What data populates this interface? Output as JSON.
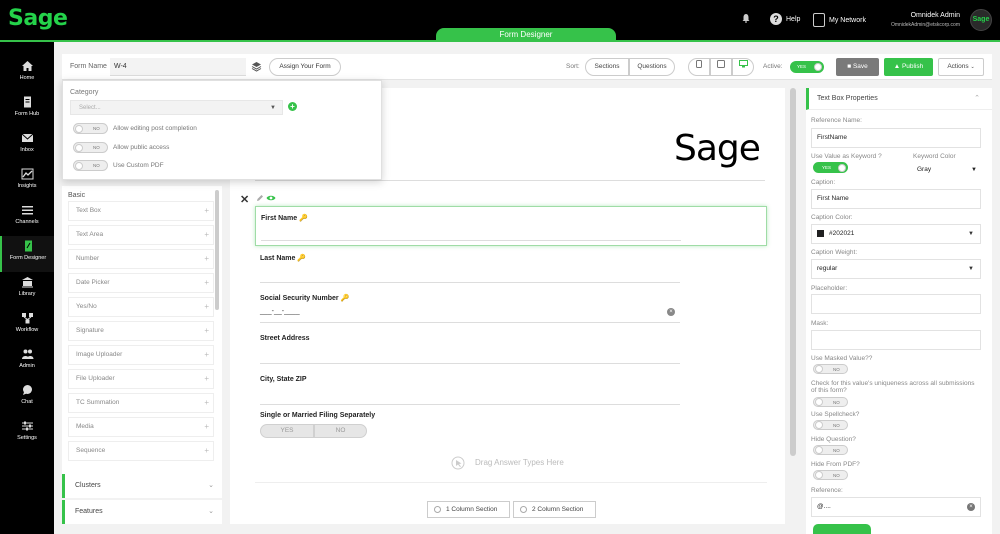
{
  "app": {
    "logo": "Sage",
    "active_tab": "Form Designer"
  },
  "topbar": {
    "help": "Help",
    "network": "My Network",
    "user_name": "Omnidek Admin",
    "user_email": "OmnidekAdmin@etskcorp.com",
    "avatar_text": "Sage"
  },
  "nav": {
    "items": [
      {
        "label": "Home",
        "icon": "home-icon"
      },
      {
        "label": "Form Hub",
        "icon": "document-icon"
      },
      {
        "label": "Inbox",
        "icon": "mail-icon"
      },
      {
        "label": "Insights",
        "icon": "chart-icon"
      },
      {
        "label": "Channels",
        "icon": "list-icon"
      },
      {
        "label": "Form Designer",
        "icon": "form-edit-icon"
      },
      {
        "label": "Library",
        "icon": "library-icon"
      },
      {
        "label": "Workflow",
        "icon": "workflow-icon"
      },
      {
        "label": "Admin",
        "icon": "users-icon"
      },
      {
        "label": "Chat",
        "icon": "chat-icon"
      },
      {
        "label": "Settings",
        "icon": "sliders-icon"
      }
    ]
  },
  "toolbar": {
    "form_name_label": "Form Name",
    "form_name_value": "W-4",
    "assign_button": "Assign Your Form",
    "sort_label": "Sort:",
    "sort_options": [
      "Sections",
      "Questions"
    ],
    "active_label": "Active:",
    "active_toggle": "YES",
    "save_button": "Save",
    "publish_button": "Publish",
    "actions_button": "Actions"
  },
  "popover": {
    "category_label": "Category",
    "category_placeholder": "Select...",
    "options": [
      {
        "toggle": "NO",
        "label": "Allow editing post completion"
      },
      {
        "toggle": "NO",
        "label": "Allow public access"
      },
      {
        "toggle": "NO",
        "label": "Use Custom PDF"
      }
    ]
  },
  "palette": {
    "section_title": "Basic",
    "items": [
      "Text Box",
      "Text Area",
      "Number",
      "Date Picker",
      "Yes/No",
      "Signature",
      "Image Uploader",
      "File Uploader",
      "TC Summation",
      "Media",
      "Sequence"
    ],
    "accordions": [
      "Clusters",
      "Features"
    ]
  },
  "canvas": {
    "header_logo": "Sage",
    "fields": [
      {
        "caption": "First Name",
        "has_key": true
      },
      {
        "caption": "Last Name",
        "has_key": true
      },
      {
        "caption": "Social Security Number",
        "has_key": true,
        "value": "___-__-____"
      },
      {
        "caption": "Street Address",
        "has_key": false
      },
      {
        "caption": "City, State ZIP",
        "has_key": false
      },
      {
        "caption": "Single or Married Filing Separately",
        "has_key": false
      }
    ],
    "yes_label": "YES",
    "no_label": "NO",
    "drop_hint": "Drag Answer Types Here",
    "column_buttons": [
      "1 Column Section",
      "2 Column Section"
    ]
  },
  "props": {
    "title": "Text Box Properties",
    "reference_name_label": "Reference Name:",
    "reference_name_value": "FirstName",
    "keyword_label": "Use Value as Keyword ?",
    "keyword_toggle": "YES",
    "keyword_color_label": "Keyword Color",
    "keyword_color_value": "Gray",
    "caption_label": "Caption:",
    "caption_value": "First Name",
    "caption_color_label": "Caption Color:",
    "caption_color_value": "#202021",
    "caption_weight_label": "Caption Weight:",
    "caption_weight_value": "regular",
    "placeholder_label": "Placeholder:",
    "mask_label": "Mask:",
    "masked_label": "Use Masked Value??",
    "unique_label": "Check for this value's uniqueness across all submissions of this form?",
    "spellcheck_label": "Use Spellcheck?",
    "hide_question_label": "Hide Question?",
    "hide_pdf_label": "Hide From PDF?",
    "reference_label": "Reference:",
    "reference_value": "@....",
    "no": "NO"
  },
  "colors": {
    "brand": "#36c24a",
    "caption_color": "#202021"
  }
}
